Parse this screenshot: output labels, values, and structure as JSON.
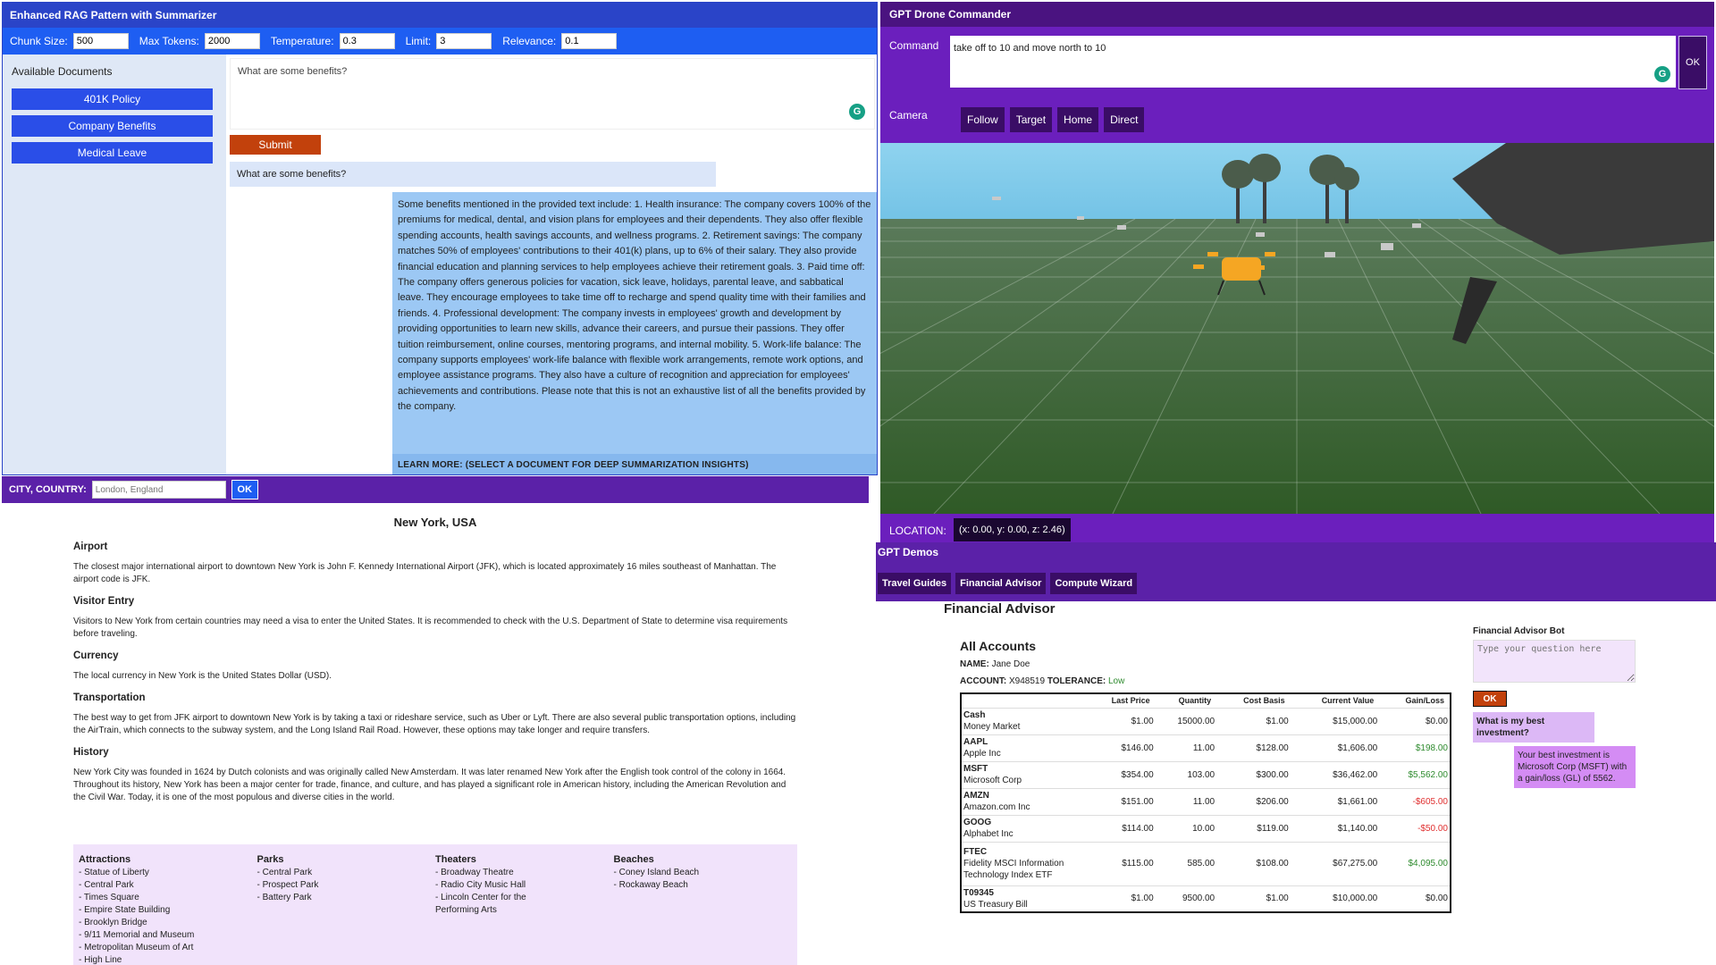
{
  "rag": {
    "title": "Enhanced RAG Pattern with Summarizer",
    "params": [
      {
        "label": "Chunk Size:",
        "value": "500"
      },
      {
        "label": "Max Tokens:",
        "value": "2000"
      },
      {
        "label": "Temperature:",
        "value": "0.3"
      },
      {
        "label": "Limit:",
        "value": "3"
      },
      {
        "label": "Relevance:",
        "value": "0.1"
      }
    ],
    "docs_heading": "Available Documents",
    "docs": [
      "401K Policy",
      "Company Benefits",
      "Medical Leave"
    ],
    "question": "What are some benefits?",
    "submit_label": "Submit",
    "user_question": "What are some benefits?",
    "answer": "Some benefits mentioned in the provided text include: 1. Health insurance: The company covers 100% of the premiums for medical, dental, and vision plans for employees and their dependents. They also offer flexible spending accounts, health savings accounts, and wellness programs. 2. Retirement savings: The company matches 50% of employees' contributions to their 401(k) plans, up to 6% of their salary. They also provide financial education and planning services to help employees achieve their retirement goals. 3. Paid time off: The company offers generous policies for vacation, sick leave, holidays, parental leave, and sabbatical leave. They encourage employees to take time off to recharge and spend quality time with their families and friends. 4. Professional development: The company invests in employees' growth and development by providing opportunities to learn new skills, advance their careers, and pursue their passions. They offer tuition reimbursement, online courses, mentoring programs, and internal mobility. 5. Work-life balance: The company supports employees' work-life balance with flexible work arrangements, remote work options, and employee assistance programs. They also have a culture of recognition and appreciation for employees' achievements and contributions. Please note that this is not an exhaustive list of all the benefits provided by the company.",
    "learn_more": "LEARN MORE: (SELECT A DOCUMENT FOR DEEP SUMMARIZATION INSIGHTS)"
  },
  "travel": {
    "bar_label": "CITY, COUNTRY:",
    "placeholder": "London, England",
    "ok_label": "OK",
    "city": "New York, USA",
    "sections": [
      {
        "heading": "Airport",
        "text": "The closest major international airport to downtown New York is John F. Kennedy International Airport (JFK), which is located approximately 16 miles southeast of Manhattan. The airport code is JFK."
      },
      {
        "heading": "Visitor Entry",
        "text": "Visitors to New York from certain countries may need a visa to enter the United States. It is recommended to check with the U.S. Department of State to determine visa requirements before traveling."
      },
      {
        "heading": "Currency",
        "text": "The local currency in New York is the United States Dollar (USD)."
      },
      {
        "heading": "Transportation",
        "text": "The best way to get from JFK airport to downtown New York is by taking a taxi or rideshare service, such as Uber or Lyft. There are also several public transportation options, including the AirTrain, which connects to the subway system, and the Long Island Rail Road. However, these options may take longer and require transfers."
      },
      {
        "heading": "History",
        "text": "New York City was founded in 1624 by Dutch colonists and was originally called New Amsterdam. It was later renamed New York after the English took control of the colony in 1664. Throughout its history, New York has been a major center for trade, finance, and culture, and has played a significant role in American history, including the American Revolution and the Civil War. Today, it is one of the most populous and diverse cities in the world."
      }
    ],
    "lists": [
      {
        "heading": "Attractions",
        "items": [
          "- Statue of Liberty",
          "- Central Park",
          "- Times Square",
          "- Empire State Building",
          "- Brooklyn Bridge",
          "- 9/11 Memorial and Museum",
          "- Metropolitan Museum of Art",
          "- High Line"
        ]
      },
      {
        "heading": "Parks",
        "items": [
          "- Central Park",
          "- Prospect Park",
          "- Battery Park"
        ]
      },
      {
        "heading": "Theaters",
        "items": [
          "- Broadway Theatre",
          "- Radio City Music Hall",
          "- Lincoln Center for the",
          "Performing Arts"
        ]
      },
      {
        "heading": "Beaches",
        "items": [
          "- Coney Island Beach",
          "- Rockaway Beach"
        ]
      }
    ]
  },
  "drone": {
    "title": "GPT Drone Commander",
    "command_label": "Command",
    "command": "take off to 10 and move north to 10",
    "ok_label": "OK",
    "camera_label": "Camera",
    "camera_buttons": [
      "Follow",
      "Target",
      "Home",
      "Direct"
    ],
    "location_label": "LOCATION:",
    "location": "(x: 0.00,  y: 0.00,  z: 2.46)"
  },
  "demos": {
    "title": "GPT Demos",
    "tabs": [
      "Travel Guides",
      "Financial Advisor",
      "Compute Wizard"
    ]
  },
  "finance": {
    "title": "Financial Advisor",
    "heading": "All Accounts",
    "name_label": "NAME:",
    "name": "Jane Doe",
    "account_label": "ACCOUNT:",
    "account": "X948519",
    "tolerance_label": "TOLERANCE:",
    "tolerance": "Low",
    "columns": [
      "",
      "Last Price",
      "Quantity",
      "Cost Basis",
      "Current Value",
      "Gain/Loss"
    ],
    "rows": [
      {
        "symbol": "Cash",
        "name": "Money Market",
        "price": "$1.00",
        "qty": "15000.00",
        "cost": "$1.00",
        "value": "$15,000.00",
        "gain": "$0.00",
        "gain_type": "zero"
      },
      {
        "symbol": "AAPL",
        "name": "Apple Inc",
        "price": "$146.00",
        "qty": "11.00",
        "cost": "$128.00",
        "value": "$1,606.00",
        "gain": "$198.00",
        "gain_type": "pos"
      },
      {
        "symbol": "MSFT",
        "name": "Microsoft Corp",
        "price": "$354.00",
        "qty": "103.00",
        "cost": "$300.00",
        "value": "$36,462.00",
        "gain": "$5,562.00",
        "gain_type": "pos"
      },
      {
        "symbol": "AMZN",
        "name": "Amazon.com Inc",
        "price": "$151.00",
        "qty": "11.00",
        "cost": "$206.00",
        "value": "$1,661.00",
        "gain": "-$605.00",
        "gain_type": "neg"
      },
      {
        "symbol": "GOOG",
        "name": "Alphabet Inc",
        "price": "$114.00",
        "qty": "10.00",
        "cost": "$119.00",
        "value": "$1,140.00",
        "gain": "-$50.00",
        "gain_type": "neg"
      },
      {
        "symbol": "FTEC",
        "name": "Fidelity MSCI Information Technology Index ETF",
        "price": "$115.00",
        "qty": "585.00",
        "cost": "$108.00",
        "value": "$67,275.00",
        "gain": "$4,095.00",
        "gain_type": "pos"
      },
      {
        "symbol": "T09345",
        "name": "US Treasury Bill",
        "price": "$1.00",
        "qty": "9500.00",
        "cost": "$1.00",
        "value": "$10,000.00",
        "gain": "$0.00",
        "gain_type": "zero"
      }
    ],
    "bot": {
      "title": "Financial Advisor Bot",
      "placeholder": "Type your question here",
      "ok_label": "OK",
      "user_msg": "What is my best investment?",
      "bot_msg": "Your best investment is Microsoft Corp (MSFT) with a gain/loss (GL) of 5562."
    }
  },
  "colors": {
    "rag_header": "#2a44c8",
    "rag_params": "#1e5ef2",
    "purple": "#6b1fbd",
    "submit": "#c2410c",
    "gain": "#2e8b2e",
    "loss": "#e03030"
  }
}
